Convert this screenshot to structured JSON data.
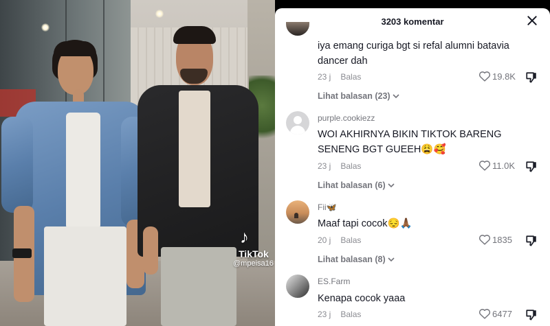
{
  "video": {
    "watermark_brand": "TikTok",
    "watermark_handle": "@mpeisa16"
  },
  "panel": {
    "title": "3203 komentar"
  },
  "comments": [
    {
      "username": "",
      "text": "iya emang curiga bgt si refal alumni batavia dancer dah",
      "time": "23 j",
      "reply_label": "Balas",
      "likes": "19.8K",
      "view_replies": "Lihat balasan (23)"
    },
    {
      "username": "purple.cookiezz",
      "text": "WOI AKHIRNYA BIKIN TIKTOK BARENG SENENG BGT GUEEH😩🥰",
      "time": "23 j",
      "reply_label": "Balas",
      "likes": "11.0K",
      "view_replies": "Lihat balasan (6)"
    },
    {
      "username": "Fii🦋",
      "text": "Maaf tapi cocok😔🙏🏾",
      "time": "20 j",
      "reply_label": "Balas",
      "likes": "1835",
      "view_replies": "Lihat balasan (8)"
    },
    {
      "username": "ES.Farm",
      "text": "Kenapa cocok yaaa",
      "time": "23 j",
      "reply_label": "Balas",
      "likes": "6477"
    }
  ],
  "icons": {
    "close": "close-icon",
    "like": "heart-outline-icon",
    "dislike": "thumbs-down-icon",
    "expand": "chevron-down-icon",
    "tiktok": "tiktok-logo-icon"
  },
  "colors": {
    "text_primary": "#161823",
    "text_secondary": "#73747b",
    "panel_bg": "#ffffff"
  }
}
